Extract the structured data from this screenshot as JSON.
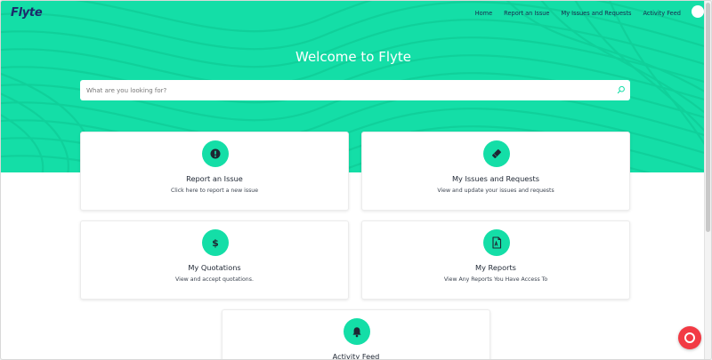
{
  "app": {
    "logo": "Flyte"
  },
  "nav": {
    "items": [
      "Home",
      "Report an Issue",
      "My Issues and Requests",
      "Activity Feed"
    ]
  },
  "hero": {
    "title": "Welcome to Flyte",
    "search_placeholder": "What are you looking for?"
  },
  "cards": [
    {
      "title": "Report an Issue",
      "description": "Click here to report a new issue",
      "icon": "exclamation-icon"
    },
    {
      "title": "My Issues and Requests",
      "description": "View and update your issues and requests",
      "icon": "ticket-icon"
    },
    {
      "title": "My Quotations",
      "description": "View and accept quotations.",
      "icon": "dollar-icon"
    },
    {
      "title": "My Reports",
      "description": "View Any Reports You Have Access To",
      "icon": "report-file-icon"
    },
    {
      "title": "Activity Feed",
      "description": "",
      "icon": "bell-icon"
    }
  ],
  "colors": {
    "accent": "#14dea7",
    "brand_text": "#1c2b6b",
    "chat": "#f23a44"
  }
}
